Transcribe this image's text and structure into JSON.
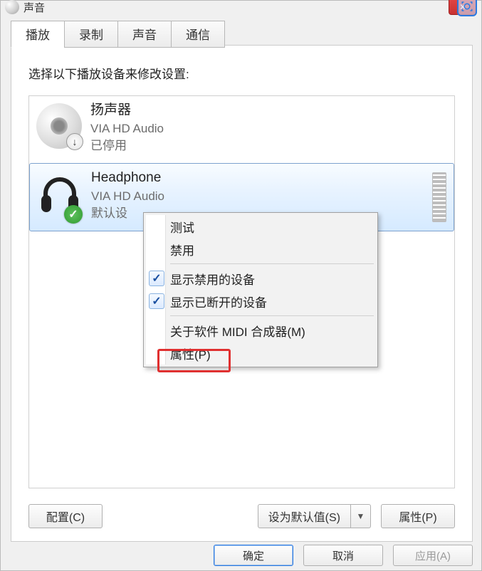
{
  "window": {
    "title": "声音"
  },
  "tabs": {
    "playback": "播放",
    "recording": "录制",
    "sounds": "声音",
    "communications": "通信"
  },
  "instruction": "选择以下播放设备来修改设置:",
  "devices": [
    {
      "name": "扬声器",
      "driver": "VIA HD Audio",
      "status": "已停用"
    },
    {
      "name": "Headphone",
      "driver": "VIA HD Audio",
      "status": "默认设"
    }
  ],
  "context_menu": {
    "test": "测试",
    "disable": "禁用",
    "show_disabled": "显示禁用的设备",
    "show_disconnected": "显示已断开的设备",
    "about_midi": "关于软件 MIDI 合成器(M)",
    "properties": "属性(P)"
  },
  "panel_buttons": {
    "configure": "配置(C)",
    "set_default": "设为默认值(S)",
    "properties": "属性(P)"
  },
  "dialog_buttons": {
    "ok": "确定",
    "cancel": "取消",
    "apply": "应用(A)"
  }
}
